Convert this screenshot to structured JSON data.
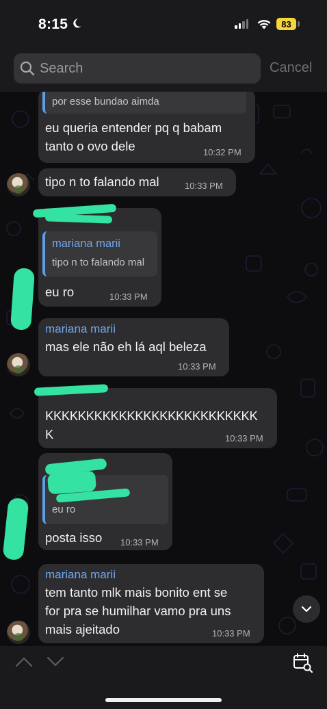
{
  "status_bar": {
    "time": "8:15",
    "battery": "83"
  },
  "search": {
    "placeholder": "Search",
    "cancel_label": "Cancel"
  },
  "messages": [
    {
      "reply_text": "por esse bundao aimda",
      "line1": "eu queria entender pq q babam",
      "line2": "tanto o ovo dele",
      "time": "10:32 PM"
    },
    {
      "text": "tipo n to falando mal",
      "time": "10:33 PM"
    },
    {
      "reply_name": "mariana marii",
      "reply_text": "tipo n to falando mal",
      "text": "eu ro",
      "time": "10:33 PM"
    },
    {
      "sender": "mariana marii",
      "text": "mas ele não eh lá aql beleza",
      "time": "10:33 PM"
    },
    {
      "line1": "KKKKKKKKKKKKKKKKKKKKKKKKKK",
      "line2": "K",
      "time": "10:33 PM"
    },
    {
      "reply_text": "eu ro",
      "text": "posta isso",
      "time": "10:33 PM"
    },
    {
      "sender": "mariana marii",
      "line1": "tem tanto mlk mais bonito ent se",
      "line2": "for pra se humilhar vamo pra uns",
      "line3": "mais ajeitado",
      "time": "10:33 PM"
    }
  ],
  "colors": {
    "accent": "#6fa8ec",
    "bubble": "#2d2d30",
    "battery": "#f4d53b",
    "scribble": "#34e2a2"
  },
  "icons": [
    "moon-icon",
    "signal-icon",
    "wifi-icon",
    "search-icon",
    "chevron-down-icon",
    "chevron-up-icon",
    "calendar-search-icon"
  ]
}
